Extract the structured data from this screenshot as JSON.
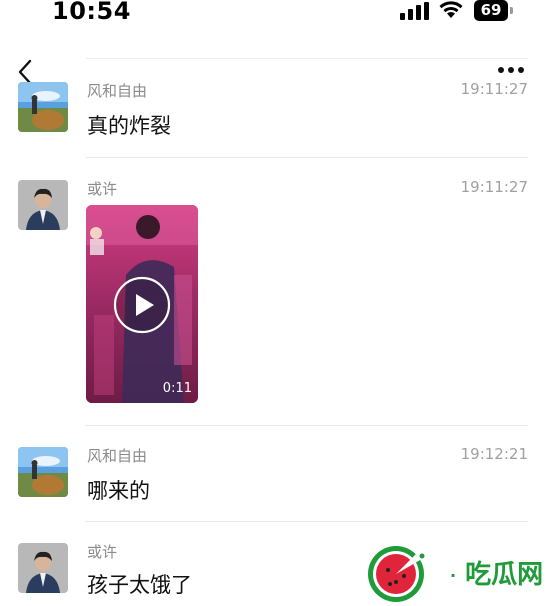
{
  "status_bar": {
    "time": "10:54",
    "battery": "69"
  },
  "nav": {
    "back_icon": "chevron-left-icon",
    "more_icon": "more-dots-icon"
  },
  "messages": [
    {
      "sender": "风和自由",
      "time": "19:11:27",
      "text": "真的炸裂"
    },
    {
      "sender": "或许",
      "time": "19:11:27",
      "video_duration": "0:11"
    },
    {
      "sender": "风和自由",
      "time": "19:12:21",
      "text": "哪来的"
    },
    {
      "sender": "或许",
      "text": "孩子太饿了"
    }
  ],
  "watermark": {
    "text": "吃瓜网"
  },
  "colors": {
    "sender": "#8a8a8a",
    "time": "#a0a0a0",
    "divider": "#e6e6e6",
    "watermark_green": "#1f9b3a",
    "watermark_red": "#e0253a"
  }
}
